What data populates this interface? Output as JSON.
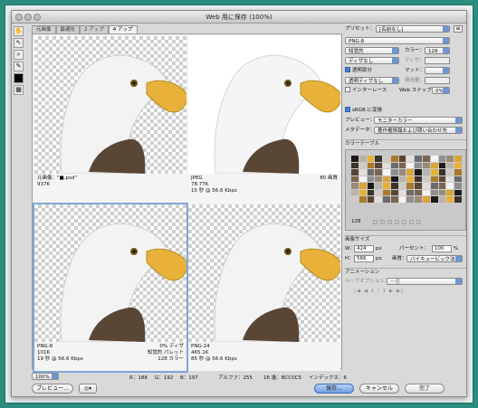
{
  "window": {
    "title": "Web 用に保存 (100%)"
  },
  "tabs": [
    "元画像",
    "最適化",
    "2 アップ",
    "4 アップ"
  ],
  "active_tab": 3,
  "panes": [
    {
      "line1": "元画像：\"■.psd\"",
      "line2": "937K",
      "line3": "",
      "right1": "",
      "right2": "",
      "right3": ""
    },
    {
      "line1": "JPEG",
      "line2": "78.77K",
      "line3": "15 秒 @ 56.6 Kbps",
      "right1": "80 画質",
      "right2": "",
      "right3": ""
    },
    {
      "line1": "PNG-8",
      "line2": "101K",
      "line3": "19 秒 @ 56.6 Kbps",
      "right1": "0% ディザ",
      "right2": "知覚的 パレット",
      "right3": "128 カラー"
    },
    {
      "line1": "PNG-24",
      "line2": "465.1K",
      "line3": "85 秒 @ 56.6 Kbps",
      "right1": "",
      "right2": "",
      "right3": ""
    }
  ],
  "settings": {
    "preset_label": "プリセット：",
    "preset_value": "[名前なし]",
    "format": "PNG-8",
    "reduction": "知覚的",
    "colors_label": "カラー：",
    "colors_value": "128",
    "dither_mode": "ディザなし",
    "dither_label": "ディザ：",
    "transparency_label": "透明部分",
    "matte_label": "マット：",
    "transparency_dither": "透明ディザなし",
    "amount_label": "適用量：",
    "interlace_label": "インターレース",
    "web_snap_label": "Web スナップ：",
    "web_snap_value": "0%",
    "srgb_label": "sRGB に変換",
    "preview_label": "プレビュー：",
    "preview_value": "モニターカラー",
    "metadata_label": "メタデータ：",
    "metadata_value": "著作権情報および問い合わせ先"
  },
  "color_table": {
    "title": "カラーテーブル",
    "count": "128"
  },
  "image_size": {
    "title": "画像サイズ",
    "w_label": "W：",
    "w_value": "424",
    "h_label": "H：",
    "h_value": "566",
    "unit": "px",
    "percent_label": "パーセント：",
    "percent_value": "100",
    "percent_unit": "%",
    "quality_label": "画質：",
    "quality_value": "バイキュービック法"
  },
  "animation": {
    "title": "アニメーション",
    "loop_label": "ループオプション：",
    "loop_value": "一度",
    "frame_label": "1 / 1"
  },
  "status": {
    "zoom": "100%",
    "r": "R：188",
    "g": "G：192",
    "b": "B：197",
    "alpha": "アルファ：255",
    "hex": "16 進：BCC0C5",
    "index": "インデックス：6"
  },
  "buttons": {
    "preview": "プレビュー...",
    "save": "保存...",
    "cancel": "キャンセル",
    "done": "完了"
  },
  "colors": {
    "accent": "#6f95d2",
    "selection": "#7fa7d6",
    "beak": "#e8b23a"
  }
}
